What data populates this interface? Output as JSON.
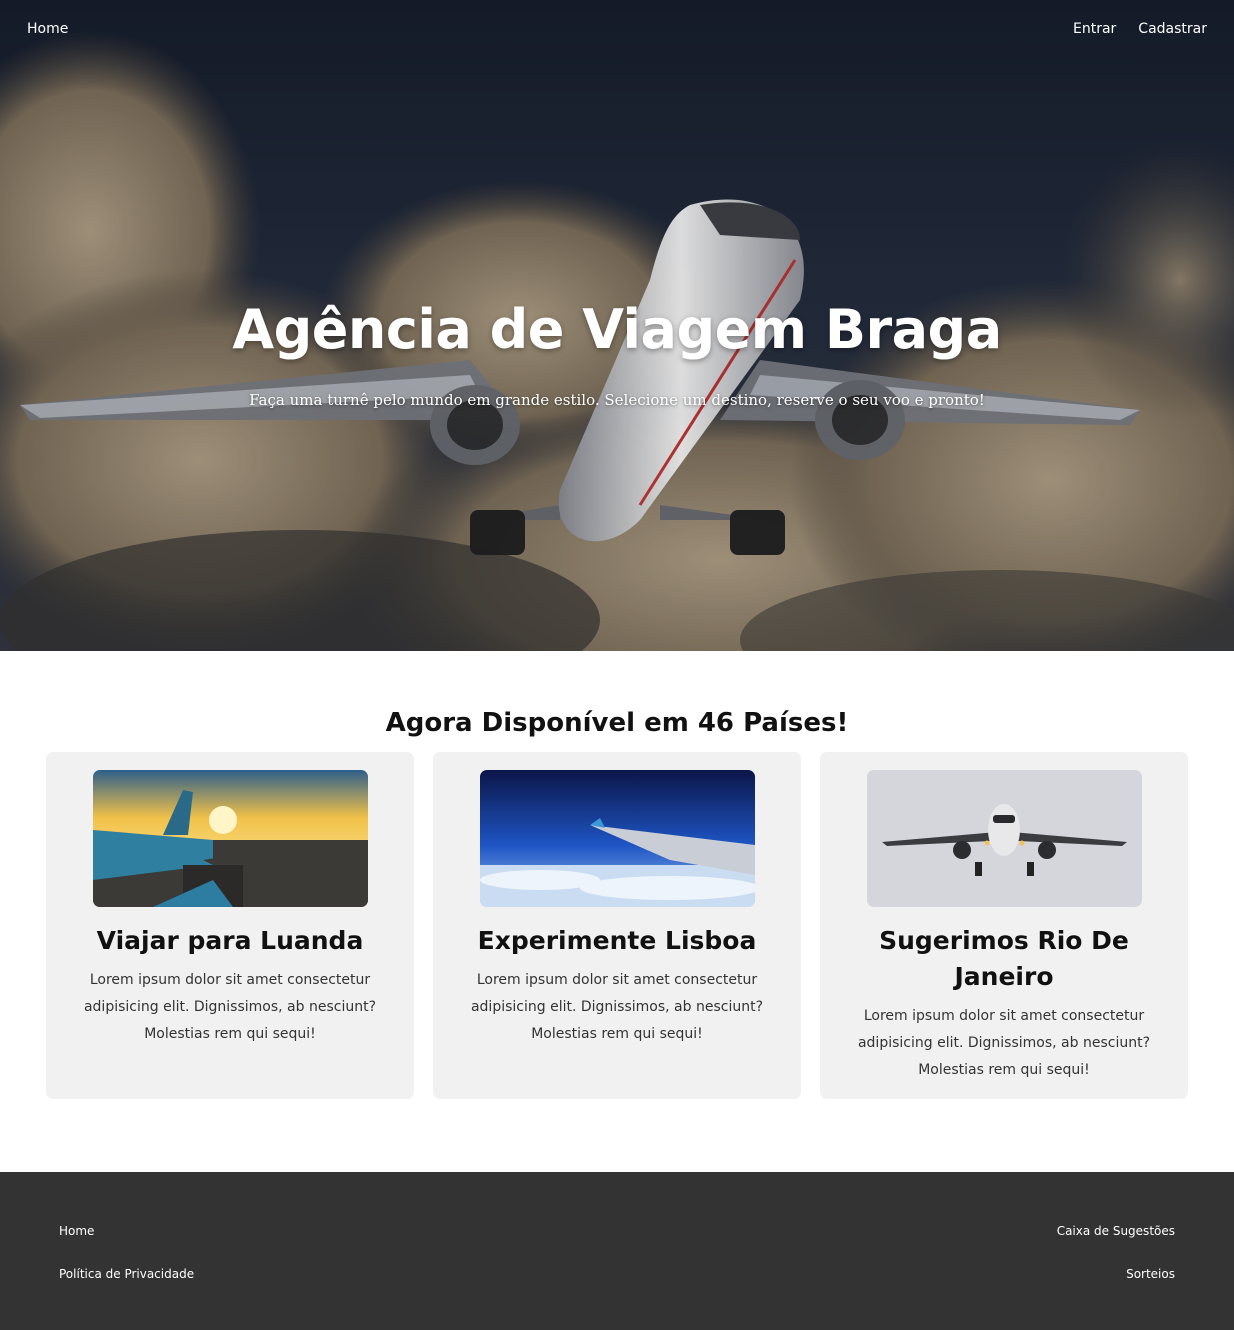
{
  "nav": {
    "home": "Home",
    "login": "Entrar",
    "signup": "Cadastrar"
  },
  "hero": {
    "title": "Agência de Viagem Braga",
    "subtitle": "Faça uma turnê pelo mundo em grande estilo. Selecione um destino, reserve o seu voo e pronto!"
  },
  "section": {
    "title": "Agora Disponível em 46 Países!"
  },
  "cards": [
    {
      "title": "Viajar para Luanda",
      "text": "Lorem ipsum dolor sit amet consectetur adipisicing elit. Dignissimos, ab nesciunt? Molestias rem qui sequi!"
    },
    {
      "title": "Experimente Lisboa",
      "text": "Lorem ipsum dolor sit amet consectetur adipisicing elit. Dignissimos, ab nesciunt? Molestias rem qui sequi!"
    },
    {
      "title": "Sugerimos Rio De Janeiro",
      "text": "Lorem ipsum dolor sit amet consectetur adipisicing elit. Dignissimos, ab nesciunt? Molestias rem qui sequi!"
    }
  ],
  "footer": {
    "home": "Home",
    "privacy": "Política de Privacidade",
    "suggestions": "Caixa de Sugestões",
    "raffles": "Sorteios"
  },
  "colors": {
    "footer_bg": "#333333",
    "card_bg": "#f1f1f1",
    "hero_sky": "#1b2538"
  }
}
